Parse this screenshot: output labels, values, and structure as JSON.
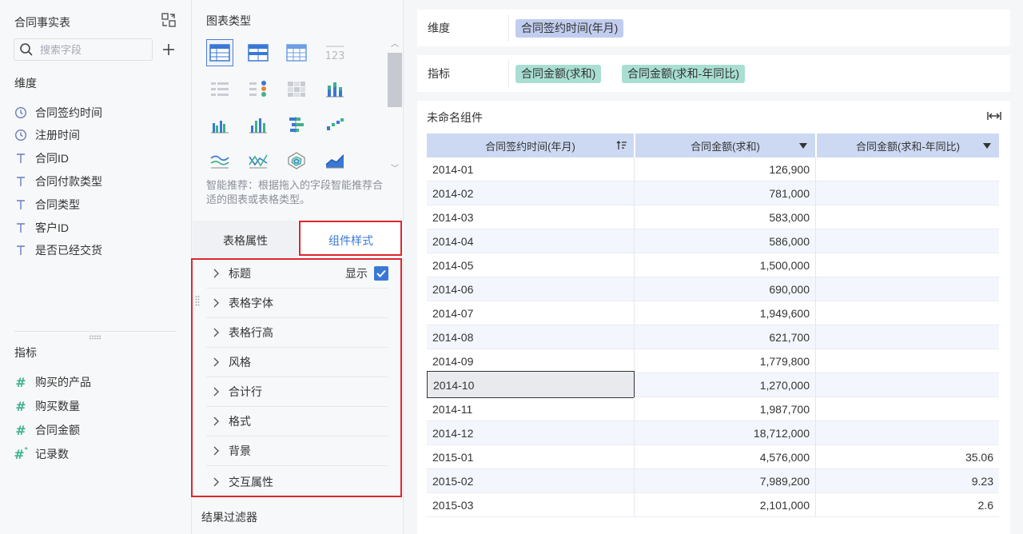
{
  "left": {
    "title": "合同事实表",
    "search_placeholder": "搜索字段",
    "dimension_label": "维度",
    "dimensions": [
      {
        "label": "合同签约时间",
        "icon": "clock-icon"
      },
      {
        "label": "注册时间",
        "icon": "clock-icon"
      },
      {
        "label": "合同ID",
        "icon": "text-field-icon"
      },
      {
        "label": "合同付款类型",
        "icon": "text-field-icon"
      },
      {
        "label": "合同类型",
        "icon": "text-field-icon"
      },
      {
        "label": "客户ID",
        "icon": "text-field-icon"
      },
      {
        "label": "是否已经交货",
        "icon": "text-field-icon"
      }
    ],
    "metric_label": "指标",
    "metrics": [
      {
        "label": "购买的产品",
        "icon": "number-field-icon"
      },
      {
        "label": "购买数量",
        "icon": "number-field-icon"
      },
      {
        "label": "合同金额",
        "icon": "number-field-icon"
      },
      {
        "label": "记录数",
        "icon": "record-count-icon"
      }
    ]
  },
  "middle": {
    "chart_type_title": "图表类型",
    "hint": "智能推荐：根据拖入的字段智能推荐合适的图表或表格类型。",
    "tabs": {
      "table_props": "表格属性",
      "component_style": "组件样式"
    },
    "active_tab": "组件样式",
    "style_items": [
      {
        "label": "标题",
        "show_label": "显示",
        "checked": true
      },
      {
        "label": "表格字体"
      },
      {
        "label": "表格行高"
      },
      {
        "label": "风格"
      },
      {
        "label": "合计行"
      },
      {
        "label": "格式"
      },
      {
        "label": "背景"
      },
      {
        "label": "交互属性"
      }
    ],
    "result_filter": "结果过滤器",
    "highlight_color": "#e0262d",
    "accent_color": "#3a78d6"
  },
  "right": {
    "dimension_shelf_label": "维度",
    "dimension_pills": [
      "合同签约时间(年月)"
    ],
    "metric_shelf_label": "指标",
    "metric_pills": [
      "合同金额(求和)",
      "合同金额(求和-年同比)"
    ],
    "widget_title": "未命名组件",
    "table": {
      "headers": [
        "合同签约时间(年月)",
        "合同金额(求和)",
        "合同金额(求和-年同比)"
      ],
      "rows": [
        [
          "2014-01",
          "126,900",
          ""
        ],
        [
          "2014-02",
          "781,000",
          ""
        ],
        [
          "2014-03",
          "583,000",
          ""
        ],
        [
          "2014-04",
          "586,000",
          ""
        ],
        [
          "2014-05",
          "1,500,000",
          ""
        ],
        [
          "2014-06",
          "690,000",
          ""
        ],
        [
          "2014-07",
          "1,949,600",
          ""
        ],
        [
          "2014-08",
          "621,700",
          ""
        ],
        [
          "2014-09",
          "1,779,800",
          ""
        ],
        [
          "2014-10",
          "1,270,000",
          ""
        ],
        [
          "2014-11",
          "1,987,700",
          ""
        ],
        [
          "2014-12",
          "18,712,000",
          ""
        ],
        [
          "2015-01",
          "4,576,000",
          "35.06"
        ],
        [
          "2015-02",
          "7,989,200",
          "9.23"
        ],
        [
          "2015-03",
          "2,101,000",
          "2.6"
        ]
      ],
      "selected_cell": "2014-10"
    }
  }
}
